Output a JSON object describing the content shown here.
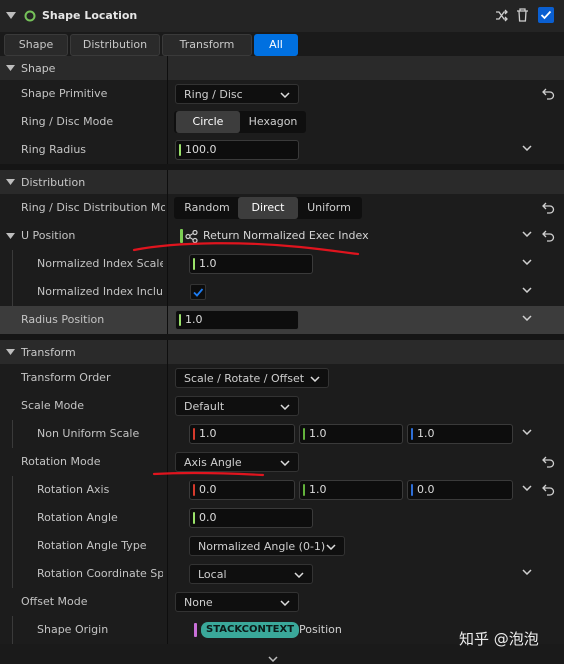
{
  "header": {
    "title": "Shape Location"
  },
  "tabs": [
    {
      "label": "Shape",
      "active": false
    },
    {
      "label": "Distribution",
      "active": false
    },
    {
      "label": "Transform",
      "active": false
    },
    {
      "label": "All",
      "active": true
    }
  ],
  "sections": {
    "shape": "Shape",
    "distribution": "Distribution",
    "transform": "Transform"
  },
  "rows": {
    "shape_primitive": {
      "label": "Shape Primitive",
      "value": "Ring / Disc"
    },
    "ring_disc_mode": {
      "label": "Ring / Disc Mode",
      "options": [
        "Circle",
        "Hexagon"
      ],
      "selected": "Circle"
    },
    "ring_radius": {
      "label": "Ring Radius",
      "value": "100.0"
    },
    "ring_disc_distribution_mode": {
      "label": "Ring / Disc Distribution Mod",
      "options": [
        "Random",
        "Direct",
        "Uniform"
      ],
      "selected": "Direct"
    },
    "u_position": {
      "label": "U Position",
      "value": "Return Normalized Exec Index"
    },
    "normalized_index_scale": {
      "label": "Normalized Index Scale",
      "value": "1.0"
    },
    "normalized_index_include": {
      "label": "Normalized Index Include",
      "checked": true
    },
    "radius_position": {
      "label": "Radius Position",
      "value": "1.0"
    },
    "transform_order": {
      "label": "Transform Order",
      "value": "Scale / Rotate / Offset"
    },
    "scale_mode": {
      "label": "Scale Mode",
      "value": "Default"
    },
    "non_uniform_scale": {
      "label": "Non Uniform Scale",
      "x": "1.0",
      "y": "1.0",
      "z": "1.0"
    },
    "rotation_mode": {
      "label": "Rotation Mode",
      "value": "Axis Angle"
    },
    "rotation_axis": {
      "label": "Rotation Axis",
      "x": "0.0",
      "y": "1.0",
      "z": "0.0"
    },
    "rotation_angle": {
      "label": "Rotation Angle",
      "value": "0.0"
    },
    "rotation_angle_type": {
      "label": "Rotation Angle Type",
      "value": "Normalized Angle (0-1)"
    },
    "rotation_coordinate_space": {
      "label": "Rotation Coordinate Spac",
      "value": "Local"
    },
    "offset_mode": {
      "label": "Offset Mode",
      "value": "None"
    },
    "shape_origin": {
      "label": "Shape Origin",
      "pill": "STACKCONTEXT",
      "value": "Position"
    }
  },
  "watermark": "知乎 @泡泡",
  "colors": {
    "accent_blue": "#0070e0",
    "channel_x": "#d63a2c",
    "channel_y": "#63b33c",
    "channel_z": "#2e6fd8",
    "scalar": "#9be36a",
    "annotation_red": "#e0141e",
    "stack_pill": "#3aa89a"
  },
  "icons": [
    "collapse-arrow-icon",
    "module-status-icon",
    "shuffle-icon",
    "trash-icon",
    "enable-checkbox-icon",
    "chevron-down-icon",
    "reset-to-default-icon",
    "dynamic-input-icon"
  ]
}
